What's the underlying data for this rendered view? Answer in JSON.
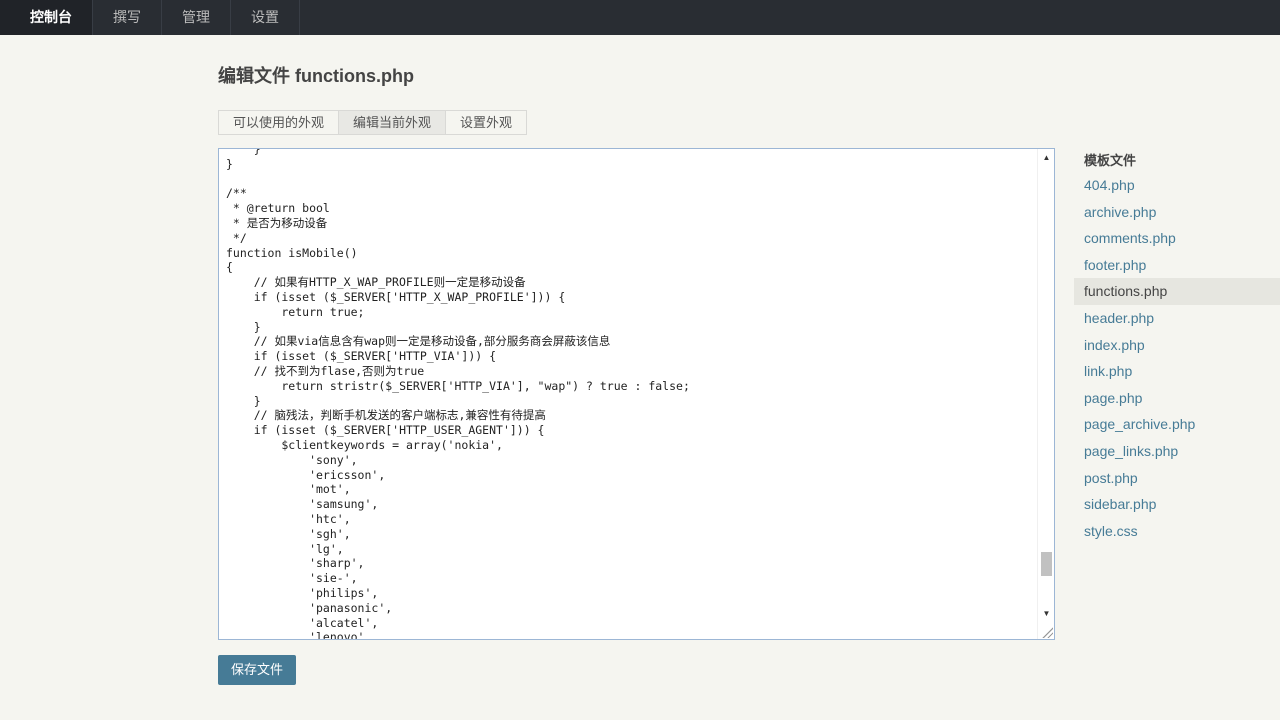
{
  "nav": {
    "items": [
      "控制台",
      "撰写",
      "管理",
      "设置"
    ]
  },
  "page": {
    "title": "编辑文件 functions.php"
  },
  "tabs": [
    "可以使用的外观",
    "编辑当前外观",
    "设置外观"
  ],
  "editor": {
    "lines": [
      "    }",
      "}",
      "",
      "/**",
      " * @return bool",
      " * 是否为移动设备",
      " */",
      "function isMobile()",
      "{",
      "    // 如果有HTTP_X_WAP_PROFILE则一定是移动设备",
      "    if (isset ($_SERVER['HTTP_X_WAP_PROFILE'])) {",
      "        return true;",
      "    }",
      "    // 如果via信息含有wap则一定是移动设备,部分服务商会屏蔽该信息",
      "    if (isset ($_SERVER['HTTP_VIA'])) {",
      "    // 找不到为flase,否则为true",
      "        return stristr($_SERVER['HTTP_VIA'], \"wap\") ? true : false;",
      "    }",
      "    // 脑残法，判断手机发送的客户端标志,兼容性有待提高",
      "    if (isset ($_SERVER['HTTP_USER_AGENT'])) {",
      "        $clientkeywords = array('nokia',",
      "            'sony',",
      "            'ericsson',",
      "            'mot',",
      "            'samsung',",
      "            'htc',",
      "            'sgh',",
      "            'lg',",
      "            'sharp',",
      "            'sie-',",
      "            'philips',",
      "            'panasonic',",
      "            'alcatel',",
      "            'lenovo',"
    ],
    "scroll_up_icon": "▲",
    "scroll_down_icon": "▼"
  },
  "save_button": "保存文件",
  "sidebar": {
    "title": "模板文件",
    "files": [
      "404.php",
      "archive.php",
      "comments.php",
      "footer.php",
      "functions.php",
      "header.php",
      "index.php",
      "link.php",
      "page.php",
      "page_archive.php",
      "page_links.php",
      "post.php",
      "sidebar.php",
      "style.css"
    ],
    "current_file": "functions.php"
  }
}
